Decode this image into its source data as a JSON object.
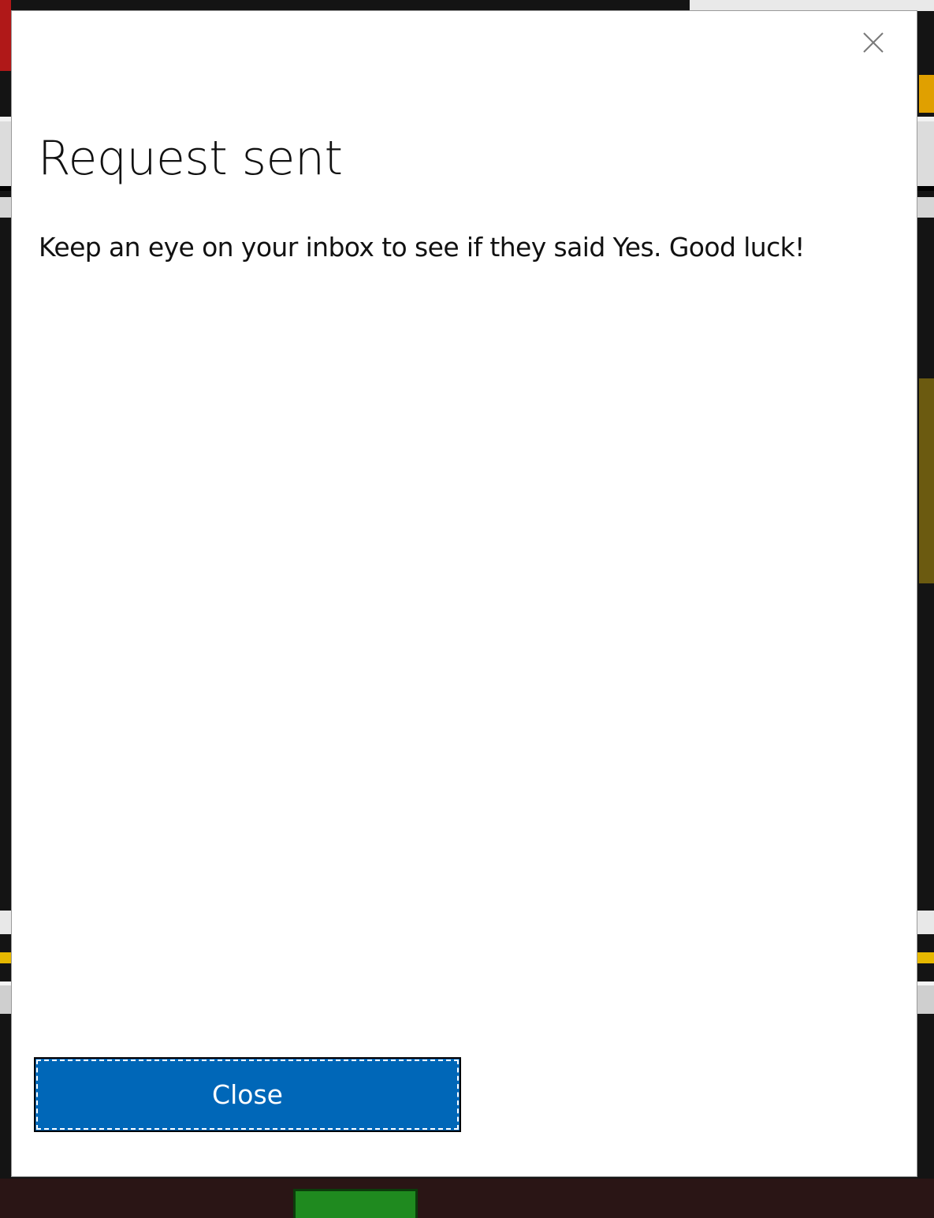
{
  "dialog": {
    "title": "Request sent",
    "message": "Keep an eye on your inbox to see if they said Yes. Good luck!",
    "close_button_label": "Close",
    "dismiss_icon": "close-icon"
  },
  "colors": {
    "primary_button": "#0067b8",
    "dialog_background": "#ffffff",
    "text": "#111111"
  }
}
